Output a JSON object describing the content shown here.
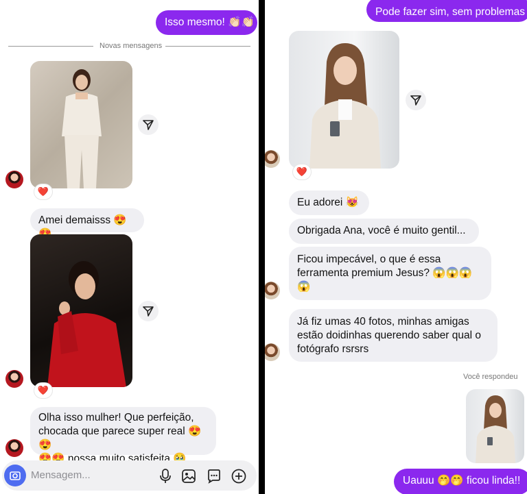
{
  "left": {
    "sent_message": "Isso mesmo! 👏🏻👏🏻",
    "new_messages_divider": "Novas mensagens",
    "msg_amei": "Amei demaisss 😍😍",
    "msg_olha_line1": "Olha isso mulher! Que perfeição,",
    "msg_olha_line2": "chocada que parece super real 😍😍",
    "msg_olha_line3": "😍😍 nossa muito satisfeita 🥹",
    "reaction": "❤️",
    "composer_placeholder": "Mensagem...",
    "icons": [
      "camera-icon",
      "microphone-icon",
      "image-icon",
      "sticker-icon",
      "plus-icon"
    ]
  },
  "right": {
    "sent_message": "Pode fazer sim, sem problemas",
    "msg_adorei": "Eu adorei 😻",
    "msg_obrigada": "Obrigada Ana, você é muito gentil...",
    "msg_ficou_line1": "Ficou impecável, o que é essa",
    "msg_ficou_line2": "ferramenta premium Jesus? 😱😱😱",
    "msg_ficou_line3": "😱",
    "msg_fiz_line1": "Já fiz umas 40 fotos, minhas amigas",
    "msg_fiz_line2": "estão doidinhas querendo saber qual o",
    "msg_fiz_line3": "fotógrafo rsrsrs",
    "you_replied": "Você respondeu",
    "last_sent": "Uauuu 🤭🤭 ficou linda!!",
    "reaction": "❤️"
  },
  "colors": {
    "sent_bubble": "#8b28ee",
    "received_bubble": "#efeff3",
    "camera_button": "#4e6cf0",
    "heart": "#e0192b"
  }
}
